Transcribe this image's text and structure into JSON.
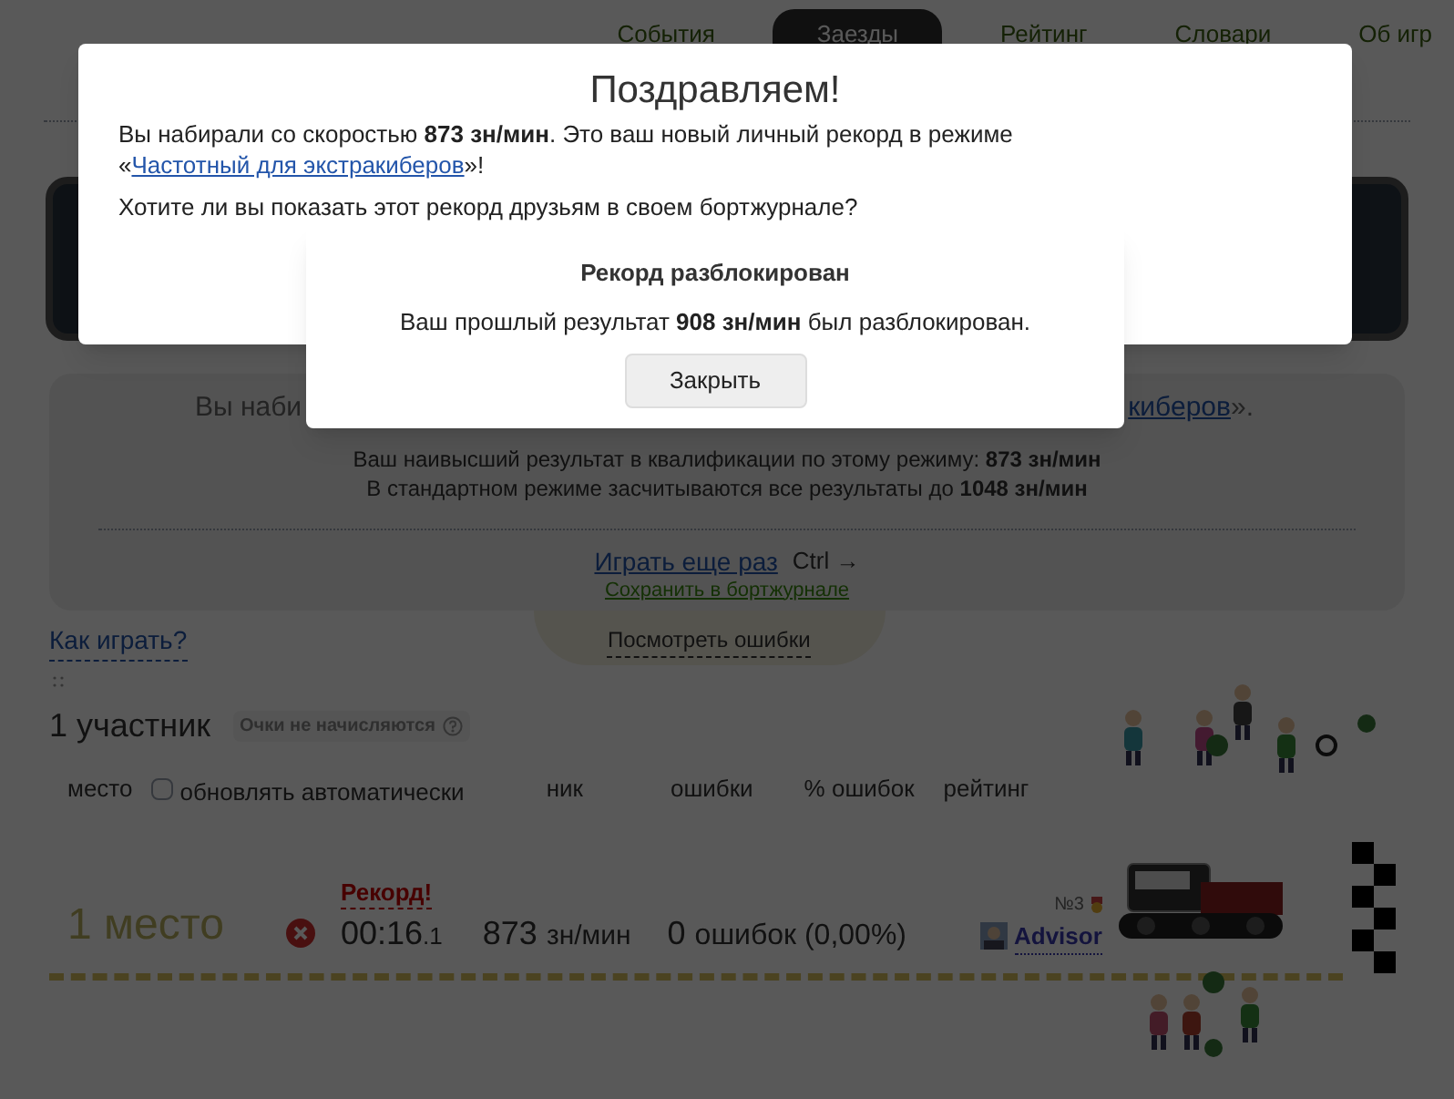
{
  "nav": [
    {
      "label": "События",
      "selected": false
    },
    {
      "label": "Заезды",
      "selected": true
    },
    {
      "label": "Рейтинг",
      "selected": false
    },
    {
      "label": "Словари",
      "selected": false
    },
    {
      "label": "Об игр",
      "selected": false
    }
  ],
  "result_panel": {
    "line_left": "Вы наби",
    "line_right_link": "киберов",
    "line_right_end": "».",
    "best": "Ваш наивысший результат в квалификации по этому режиму: **873 зн/мин**",
    "standard": "В стандартном режиме засчитываются все результаты до **1048 зн/мин**",
    "play_again": "Играть еще раз",
    "shortcut": "Ctrl →",
    "save_link": "Сохранить в бортжурнале",
    "errors_link": "Посмотреть ошибки"
  },
  "how_to_play": "Как играть?",
  "participants": {
    "count": "1 участник",
    "badge": "Очки не начисляются",
    "auto_update": {
      "label": "обновлять автоматически",
      "checked": false
    },
    "columns": [
      "место",
      "ник",
      "ошибки",
      "% ошибок",
      "рейтинг"
    ],
    "rows": [
      {
        "place": "1 место",
        "record": "Рекорд!",
        "time": "00:16",
        "time_fraction": ".1",
        "speed": "873",
        "speed_unit": "зн/мин",
        "errors": "0",
        "errors_text": "ошибок (0,00%)",
        "rank": "№3",
        "name": "Advisor"
      }
    ]
  },
  "dialog": {
    "title": "Поздравляем!",
    "before": "Вы набирали со скоростью **873 зн/мин**. Это ваш новый личный рекорд в режиме «",
    "link": "Частотный для экстракиберов",
    "after": "»!",
    "question": "Хотите ли вы показать этот рекорд друзьям в своем бортжурнале?"
  },
  "unlock_dialog": {
    "title": "Рекорд разблокирован",
    "message": "Ваш прошлый результат **908 зн/мин** был разблокирован.",
    "button": "Закрыть"
  }
}
